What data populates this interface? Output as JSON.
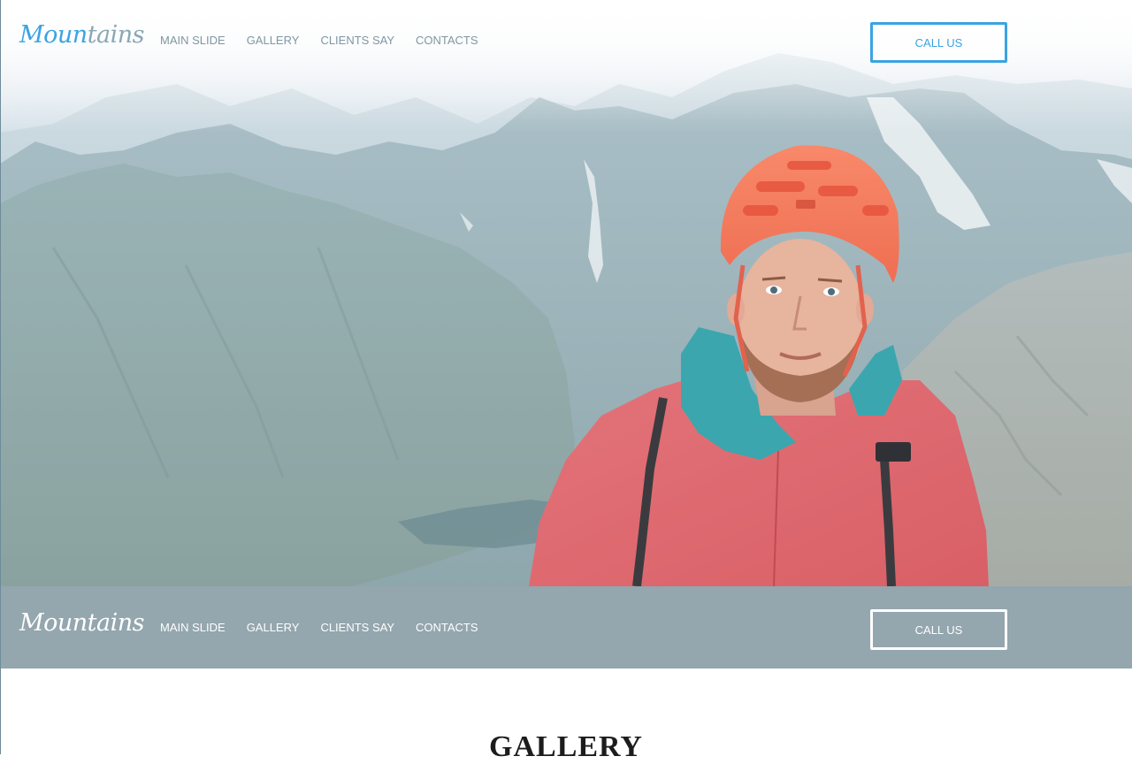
{
  "brand": {
    "logo_part1": "Moun",
    "logo_part2": "tains",
    "logo_full": "Mountains"
  },
  "nav": {
    "items": [
      {
        "label": "MAIN SLIDE"
      },
      {
        "label": "GALLERY"
      },
      {
        "label": "CLIENTS SAY"
      },
      {
        "label": "CONTACTS"
      }
    ],
    "cta_label": "CALL US"
  },
  "hero": {
    "image": "mountain-climber-photo"
  },
  "gallery": {
    "title": "GALLERY"
  },
  "colors": {
    "accent": "#3aa3e3",
    "nav_text": "#7f97a3",
    "sticky_bar": "#94a6ae",
    "jacket": "#e0676a",
    "helmet": "#f47a5c"
  }
}
